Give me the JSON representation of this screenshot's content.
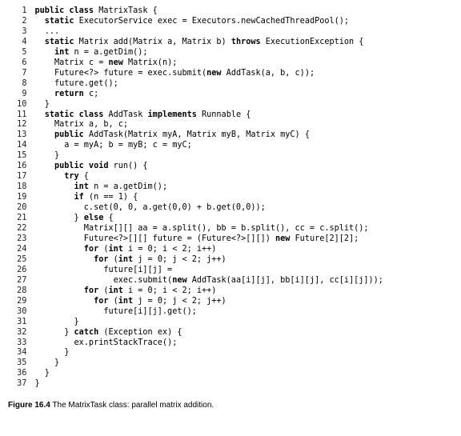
{
  "caption": {
    "label": "Figure 16.4",
    "text": "The MatrixTask class: parallel matrix addition."
  },
  "line_numbers": [
    "1",
    "2",
    "3",
    "4",
    "5",
    "6",
    "7",
    "8",
    "9",
    "10",
    "11",
    "12",
    "13",
    "14",
    "15",
    "16",
    "17",
    "18",
    "19",
    "20",
    "21",
    "22",
    "23",
    "24",
    "25",
    "26",
    "27",
    "28",
    "29",
    "30",
    "31",
    "32",
    "33",
    "34",
    "35",
    "36",
    "37"
  ],
  "code": [
    {
      "i": 0,
      "spans": [
        {
          "k": true,
          "t": "public class"
        },
        {
          "k": false,
          "t": " MatrixTask {"
        }
      ]
    },
    {
      "i": 1,
      "spans": [
        {
          "k": true,
          "t": "static"
        },
        {
          "k": false,
          "t": " ExecutorService exec = Executors.newCachedThreadPool();"
        }
      ]
    },
    {
      "i": 1,
      "spans": [
        {
          "k": false,
          "t": "..."
        }
      ]
    },
    {
      "i": 1,
      "spans": [
        {
          "k": true,
          "t": "static"
        },
        {
          "k": false,
          "t": " Matrix add(Matrix a, Matrix b) "
        },
        {
          "k": true,
          "t": "throws"
        },
        {
          "k": false,
          "t": " ExecutionException {"
        }
      ]
    },
    {
      "i": 2,
      "spans": [
        {
          "k": true,
          "t": "int"
        },
        {
          "k": false,
          "t": " n = a.getDim();"
        }
      ]
    },
    {
      "i": 2,
      "spans": [
        {
          "k": false,
          "t": "Matrix c = "
        },
        {
          "k": true,
          "t": "new"
        },
        {
          "k": false,
          "t": " Matrix(n);"
        }
      ]
    },
    {
      "i": 2,
      "spans": [
        {
          "k": false,
          "t": "Future<?> future = exec.submit("
        },
        {
          "k": true,
          "t": "new"
        },
        {
          "k": false,
          "t": " AddTask(a, b, c));"
        }
      ]
    },
    {
      "i": 2,
      "spans": [
        {
          "k": false,
          "t": "future.get();"
        }
      ]
    },
    {
      "i": 2,
      "spans": [
        {
          "k": true,
          "t": "return"
        },
        {
          "k": false,
          "t": " c;"
        }
      ]
    },
    {
      "i": 1,
      "spans": [
        {
          "k": false,
          "t": "}"
        }
      ]
    },
    {
      "i": 1,
      "spans": [
        {
          "k": true,
          "t": "static class"
        },
        {
          "k": false,
          "t": " AddTask "
        },
        {
          "k": true,
          "t": "implements"
        },
        {
          "k": false,
          "t": " Runnable {"
        }
      ]
    },
    {
      "i": 2,
      "spans": [
        {
          "k": false,
          "t": "Matrix a, b, c;"
        }
      ]
    },
    {
      "i": 2,
      "spans": [
        {
          "k": true,
          "t": "public"
        },
        {
          "k": false,
          "t": " AddTask(Matrix myA, Matrix myB, Matrix myC) {"
        }
      ]
    },
    {
      "i": 3,
      "spans": [
        {
          "k": false,
          "t": "a = myA; b = myB; c = myC;"
        }
      ]
    },
    {
      "i": 2,
      "spans": [
        {
          "k": false,
          "t": "}"
        }
      ]
    },
    {
      "i": 2,
      "spans": [
        {
          "k": true,
          "t": "public void"
        },
        {
          "k": false,
          "t": " run() {"
        }
      ]
    },
    {
      "i": 3,
      "spans": [
        {
          "k": true,
          "t": "try"
        },
        {
          "k": false,
          "t": " {"
        }
      ]
    },
    {
      "i": 4,
      "spans": [
        {
          "k": true,
          "t": "int"
        },
        {
          "k": false,
          "t": " n = a.getDim();"
        }
      ]
    },
    {
      "i": 4,
      "spans": [
        {
          "k": true,
          "t": "if"
        },
        {
          "k": false,
          "t": " (n == 1) {"
        }
      ]
    },
    {
      "i": 5,
      "spans": [
        {
          "k": false,
          "t": "c.set(0, 0, a.get(0,0) + b.get(0,0));"
        }
      ]
    },
    {
      "i": 4,
      "spans": [
        {
          "k": false,
          "t": "} "
        },
        {
          "k": true,
          "t": "else"
        },
        {
          "k": false,
          "t": " {"
        }
      ]
    },
    {
      "i": 5,
      "spans": [
        {
          "k": false,
          "t": "Matrix[][] aa = a.split(), bb = b.split(), cc = c.split();"
        }
      ]
    },
    {
      "i": 5,
      "spans": [
        {
          "k": false,
          "t": "Future<?>[][] future = (Future<?>[][]) "
        },
        {
          "k": true,
          "t": "new"
        },
        {
          "k": false,
          "t": " Future[2][2];"
        }
      ]
    },
    {
      "i": 5,
      "spans": [
        {
          "k": true,
          "t": "for"
        },
        {
          "k": false,
          "t": " ("
        },
        {
          "k": true,
          "t": "int"
        },
        {
          "k": false,
          "t": " i = 0; i < 2; i++)"
        }
      ]
    },
    {
      "i": 6,
      "spans": [
        {
          "k": true,
          "t": "for"
        },
        {
          "k": false,
          "t": " ("
        },
        {
          "k": true,
          "t": "int"
        },
        {
          "k": false,
          "t": " j = 0; j < 2; j++)"
        }
      ]
    },
    {
      "i": 7,
      "spans": [
        {
          "k": false,
          "t": "future[i][j] ="
        }
      ]
    },
    {
      "i": 8,
      "spans": [
        {
          "k": false,
          "t": "exec.submit("
        },
        {
          "k": true,
          "t": "new"
        },
        {
          "k": false,
          "t": " AddTask(aa[i][j], bb[i][j], cc[i][j]));"
        }
      ]
    },
    {
      "i": 5,
      "spans": [
        {
          "k": true,
          "t": "for"
        },
        {
          "k": false,
          "t": " ("
        },
        {
          "k": true,
          "t": "int"
        },
        {
          "k": false,
          "t": " i = 0; i < 2; i++)"
        }
      ]
    },
    {
      "i": 6,
      "spans": [
        {
          "k": true,
          "t": "for"
        },
        {
          "k": false,
          "t": " ("
        },
        {
          "k": true,
          "t": "int"
        },
        {
          "k": false,
          "t": " j = 0; j < 2; j++)"
        }
      ]
    },
    {
      "i": 7,
      "spans": [
        {
          "k": false,
          "t": "future[i][j].get();"
        }
      ]
    },
    {
      "i": 4,
      "spans": [
        {
          "k": false,
          "t": "}"
        }
      ]
    },
    {
      "i": 3,
      "spans": [
        {
          "k": false,
          "t": "} "
        },
        {
          "k": true,
          "t": "catch"
        },
        {
          "k": false,
          "t": " (Exception ex) {"
        }
      ]
    },
    {
      "i": 4,
      "spans": [
        {
          "k": false,
          "t": "ex.printStackTrace();"
        }
      ]
    },
    {
      "i": 3,
      "spans": [
        {
          "k": false,
          "t": "}"
        }
      ]
    },
    {
      "i": 2,
      "spans": [
        {
          "k": false,
          "t": "}"
        }
      ]
    },
    {
      "i": 1,
      "spans": [
        {
          "k": false,
          "t": "}"
        }
      ]
    },
    {
      "i": 0,
      "spans": [
        {
          "k": false,
          "t": "}"
        }
      ]
    }
  ],
  "indent_unit": "  "
}
